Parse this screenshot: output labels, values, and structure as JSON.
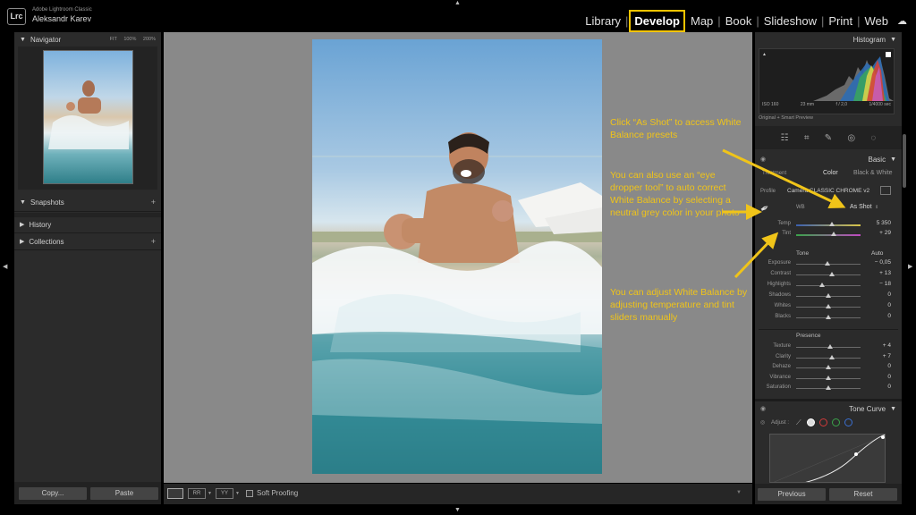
{
  "app": {
    "name": "Adobe Lightroom Classic",
    "user": "Aleksandr Karev",
    "logo": "Lrc"
  },
  "modules": [
    {
      "label": "Library",
      "active": false
    },
    {
      "label": "Develop",
      "active": true
    },
    {
      "label": "Map",
      "active": false
    },
    {
      "label": "Book",
      "active": false
    },
    {
      "label": "Slideshow",
      "active": false
    },
    {
      "label": "Print",
      "active": false
    },
    {
      "label": "Web",
      "active": false
    }
  ],
  "left": {
    "navigator": {
      "title": "Navigator",
      "zoom": [
        "FIT",
        "100%",
        "200%"
      ]
    },
    "sections": [
      "Snapshots",
      "History",
      "Collections"
    ],
    "copy_label": "Copy...",
    "paste_label": "Paste"
  },
  "bottom": {
    "soft_proofing": "Soft Proofing"
  },
  "right": {
    "histogram": {
      "title": "Histogram",
      "iso": "ISO 160",
      "focal": "23 mm",
      "aperture": "f / 2,0",
      "shutter": "1/4000 sec",
      "preview": "Original + Smart Preview"
    },
    "basic": {
      "title": "Basic",
      "treatment": "Treatment",
      "color": "Color",
      "bw": "Black & White",
      "profile_label": "Profile",
      "profile_value": "Camera CLASSIC CHROME v2",
      "wb_label": "WB",
      "wb_value": "As Shot"
    },
    "wb_sliders": [
      {
        "label": "Temp",
        "value": "5 350",
        "pos": 0.55
      },
      {
        "label": "Tint",
        "value": "+ 29",
        "pos": 0.58
      }
    ],
    "tone": {
      "title": "Tone",
      "auto": "Auto"
    },
    "tone_sliders": [
      {
        "label": "Exposure",
        "value": "− 0,05",
        "pos": 0.48
      },
      {
        "label": "Contrast",
        "value": "+ 13",
        "pos": 0.55
      },
      {
        "label": "Highlights",
        "value": "− 18",
        "pos": 0.4
      },
      {
        "label": "Shadows",
        "value": "0",
        "pos": 0.5
      },
      {
        "label": "Whites",
        "value": "0",
        "pos": 0.5
      },
      {
        "label": "Blacks",
        "value": "0",
        "pos": 0.5
      }
    ],
    "presence": {
      "title": "Presence"
    },
    "presence_sliders": [
      {
        "label": "Texture",
        "value": "+ 4",
        "pos": 0.53
      },
      {
        "label": "Clarity",
        "value": "+ 7",
        "pos": 0.55
      },
      {
        "label": "Dehaze",
        "value": "0",
        "pos": 0.5
      },
      {
        "label": "Vibrance",
        "value": "0",
        "pos": 0.5
      },
      {
        "label": "Saturation",
        "value": "0",
        "pos": 0.5
      }
    ],
    "tone_curve": {
      "title": "Tone Curve",
      "adjust": "Adjust :"
    },
    "previous_label": "Previous",
    "reset_label": "Reset"
  },
  "annotations": [
    "Click “As Shot” to access White Balance presets",
    "You can also use an “eye dropper tool” to auto correct White Balance by selecting a neutral grey color in your photo",
    "You can adjust White Balance by adjusting temperature and tint sliders manually"
  ],
  "colors": {
    "highlight": "#f5c400",
    "annotation": "#f0c419"
  }
}
